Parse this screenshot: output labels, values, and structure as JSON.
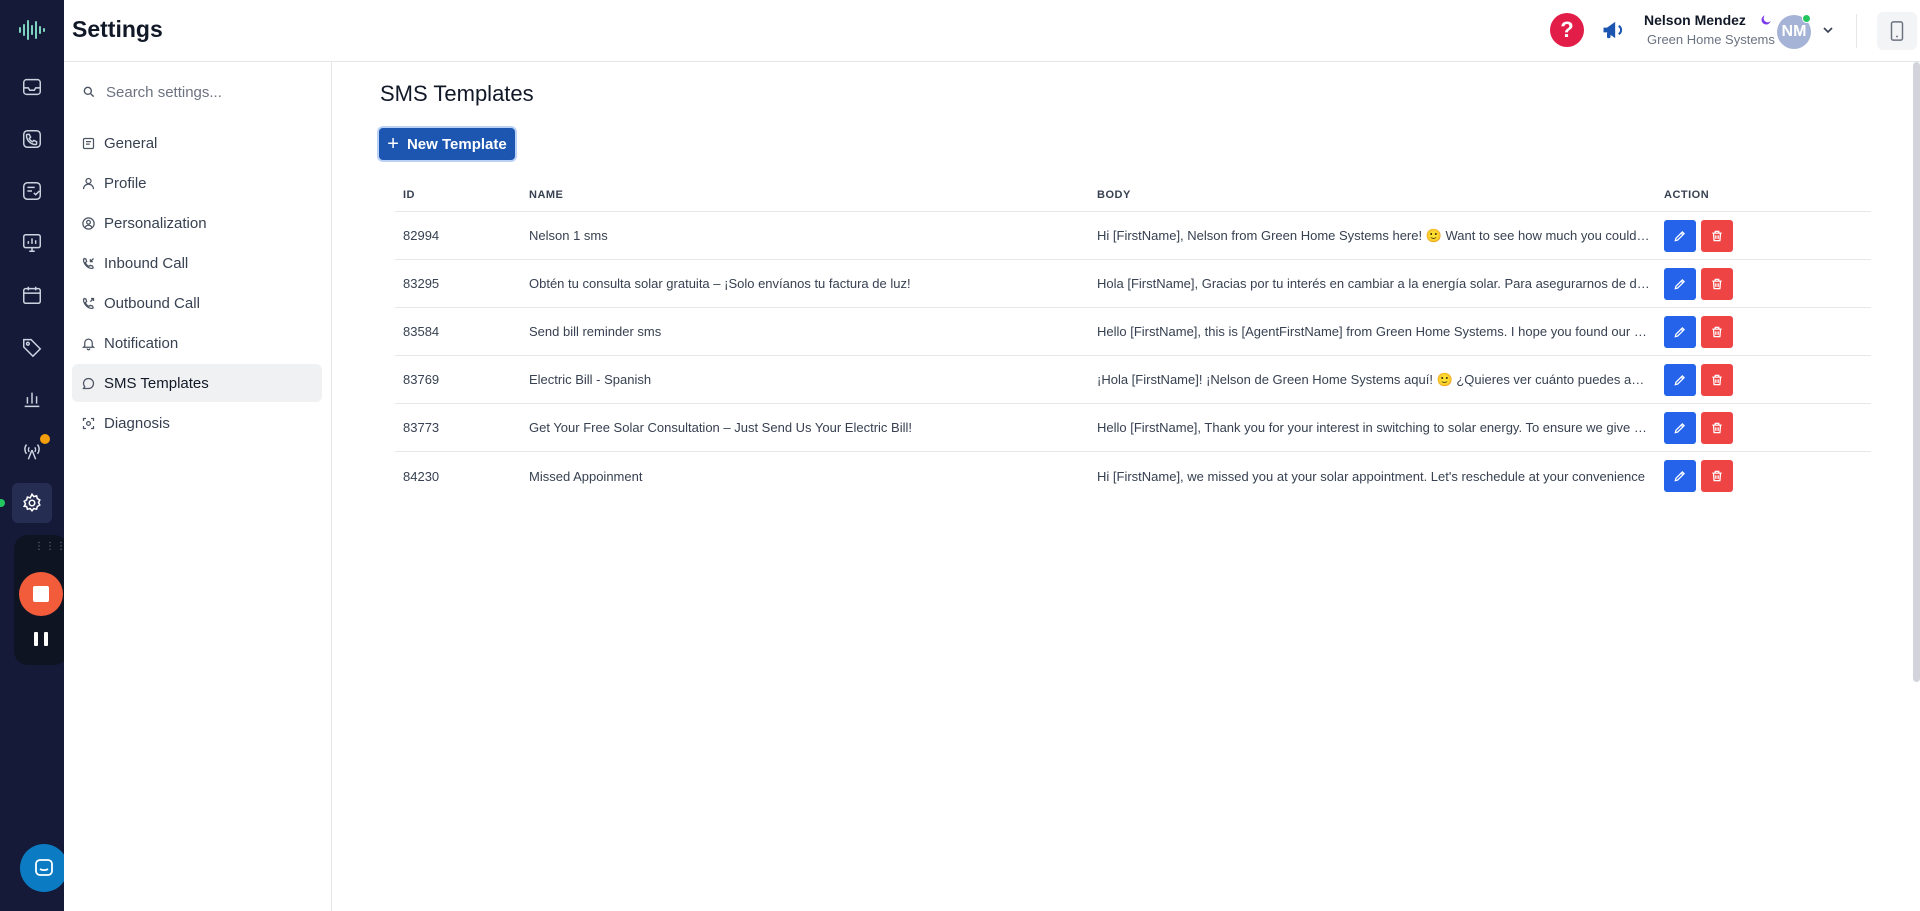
{
  "header": {
    "title": "Settings"
  },
  "user": {
    "name": "Nelson Mendez",
    "org": "Green Home Systems",
    "initials": "NM"
  },
  "help": {
    "label": "?"
  },
  "search": {
    "placeholder": "Search settings..."
  },
  "nav": [
    {
      "label": "General",
      "icon": "document-icon"
    },
    {
      "label": "Profile",
      "icon": "user-icon"
    },
    {
      "label": "Personalization",
      "icon": "user-circle-icon"
    },
    {
      "label": "Inbound Call",
      "icon": "phone-incoming-icon"
    },
    {
      "label": "Outbound Call",
      "icon": "phone-outgoing-icon"
    },
    {
      "label": "Notification",
      "icon": "bell-icon"
    },
    {
      "label": "SMS Templates",
      "icon": "message-icon",
      "active": true
    },
    {
      "label": "Diagnosis",
      "icon": "scan-icon"
    }
  ],
  "page": {
    "title": "SMS Templates",
    "new_button": "New Template"
  },
  "table": {
    "headers": {
      "id": "ID",
      "name": "NAME",
      "body": "BODY",
      "action": "ACTION"
    },
    "rows": [
      {
        "id": "82994",
        "name": "Nelson 1 sms",
        "body": "Hi [FirstName], Nelson from Green Home Systems here! 🙂 Want to see how much you could save on your electric bill?"
      },
      {
        "id": "83295",
        "name": "Obtén tu consulta solar gratuita – ¡Solo envíanos tu factura de luz!",
        "body": "Hola [FirstName], Gracias por tu interés en cambiar a la energía solar. Para asegurarnos de darte la mejor propuesta"
      },
      {
        "id": "83584",
        "name": "Send bill reminder sms",
        "body": "Hello [FirstName], this is [AgentFirstName] from Green Home Systems. I hope you found our conversation helpful"
      },
      {
        "id": "83769",
        "name": "Electric Bill - Spanish",
        "body": "¡Hola [FirstName]! ¡Nelson de Green Home Systems aquí! 🙂 ¿Quieres ver cuánto puedes ahorrar en tu factura?"
      },
      {
        "id": "83773",
        "name": "Get Your Free Solar Consultation – Just Send Us Your Electric Bill!",
        "body": "Hello [FirstName], Thank you for your interest in switching to solar energy. To ensure we give you the best proposal"
      },
      {
        "id": "84230",
        "name": "Missed Appoinment",
        "body": "Hi [FirstName], we missed you at your solar appointment. Let's reschedule at your convenience"
      }
    ]
  },
  "colors": {
    "rail": "#141a38",
    "primary": "#1d56b0",
    "edit": "#2563eb",
    "delete": "#ef4444",
    "help": "#e11d48"
  }
}
